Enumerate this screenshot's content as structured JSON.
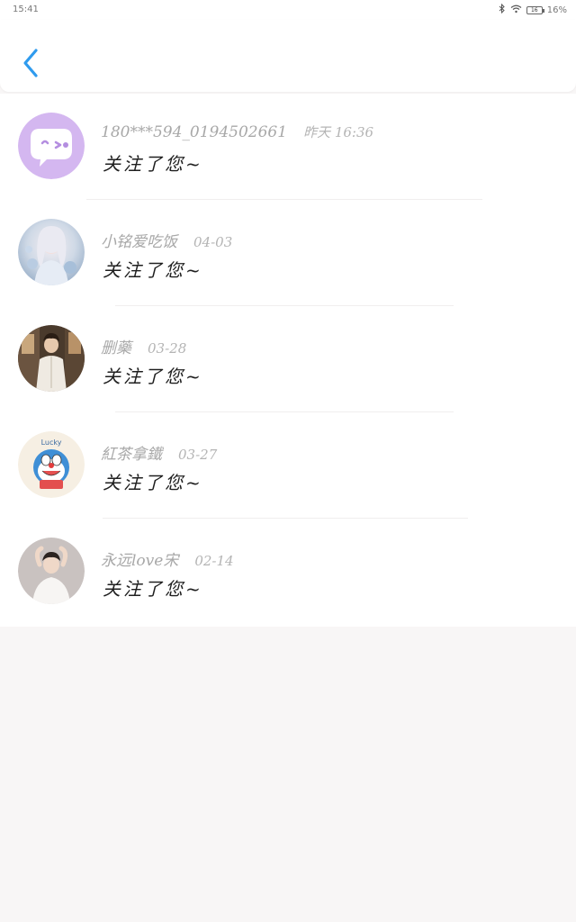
{
  "status_bar": {
    "time": "15:41",
    "battery": "16%",
    "battery_icon_level": "16"
  },
  "header": {
    "back_icon": "chevron-left-icon"
  },
  "colors": {
    "accent": "#2f9bee",
    "name_gray": "#a8a8a8",
    "message_black": "#1f1f1f",
    "background": "#f8f6f6"
  },
  "followers": [
    {
      "name": "180***594_0194502661",
      "time": "昨天 16:36",
      "message": "关注了您~"
    },
    {
      "name": "小铭爱吃饭",
      "time": "04-03",
      "message": "关注了您~"
    },
    {
      "name": "删藥",
      "time": "03-28",
      "message": "关注了您~"
    },
    {
      "name": "紅茶拿鐵",
      "time": "03-27",
      "message": "关注了您~"
    },
    {
      "name": "永远love宋",
      "time": "02-14",
      "message": "关注了您~"
    }
  ],
  "avatar_badges": {
    "lucky_text": "Lucky"
  }
}
